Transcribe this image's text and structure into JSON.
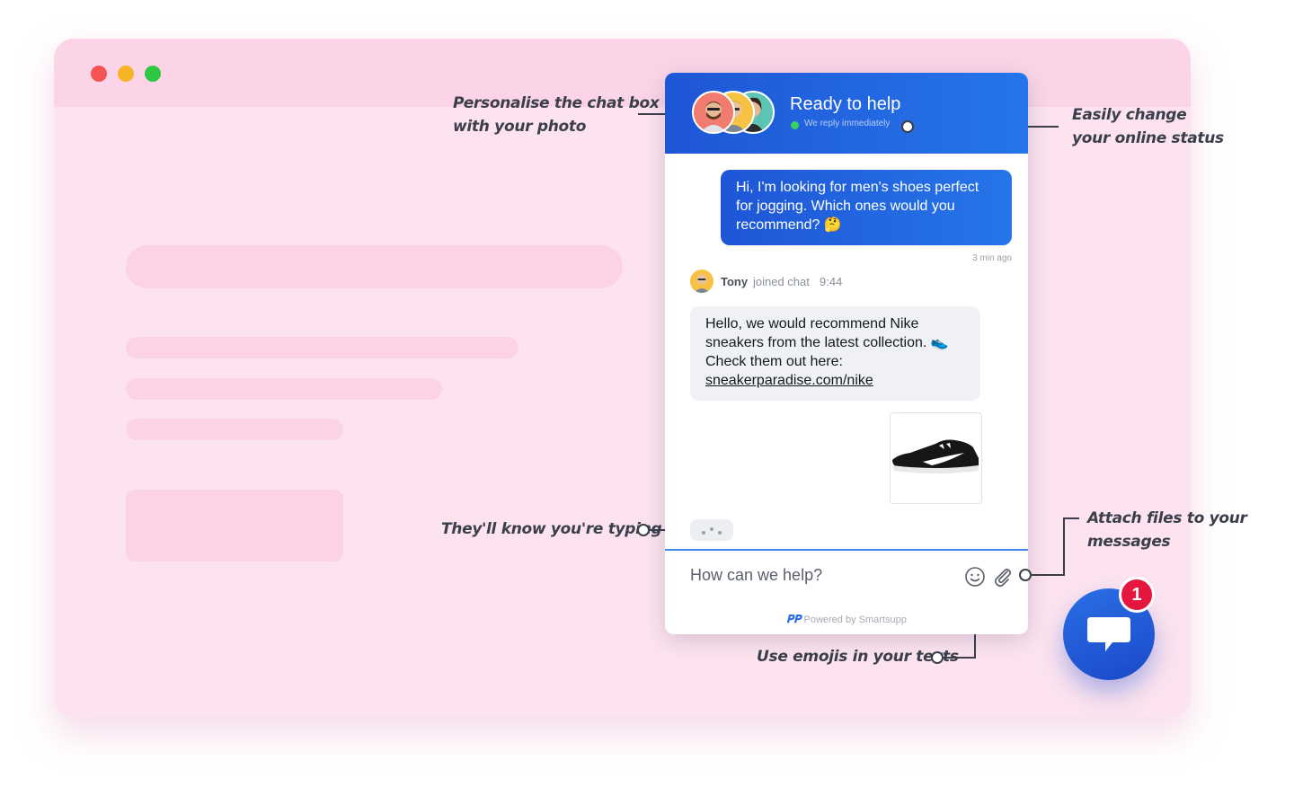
{
  "annotations": {
    "personalise": "Personalise the chat box\nwith your photo",
    "status": "Easily change\nyour online status",
    "typing": "They'll know you're typing",
    "attach": "Attach files to your messages",
    "emojis": "Use emojis in your texts"
  },
  "chat": {
    "header_title": "Ready to help",
    "status_text": "We reply immediately",
    "user_message": "Hi, I'm looking for men's shoes perfect for jogging. Which ones would you recommend? 🤔",
    "time_ago": "3 min ago",
    "agent_name": "Tony",
    "agent_joined": "joined chat",
    "agent_time": "9:44",
    "agent_message": "Hello, we would recommend Nike sneakers from the latest collection. 👟 Check them out here:",
    "agent_link": "sneakerparadise.com/nike",
    "composer_placeholder": "How can we help?",
    "powered_by": "Powered by Smartsupp"
  },
  "launcher": {
    "badge_count": "1"
  },
  "colors": {
    "brand_blue": "#1e56d6",
    "window_bg": "#fce3ef",
    "badge_red": "#e5173f"
  },
  "icons": [
    "emoji-icon",
    "paperclip-icon",
    "chat-bubble-icon",
    "smartsupp-logo-icon"
  ]
}
